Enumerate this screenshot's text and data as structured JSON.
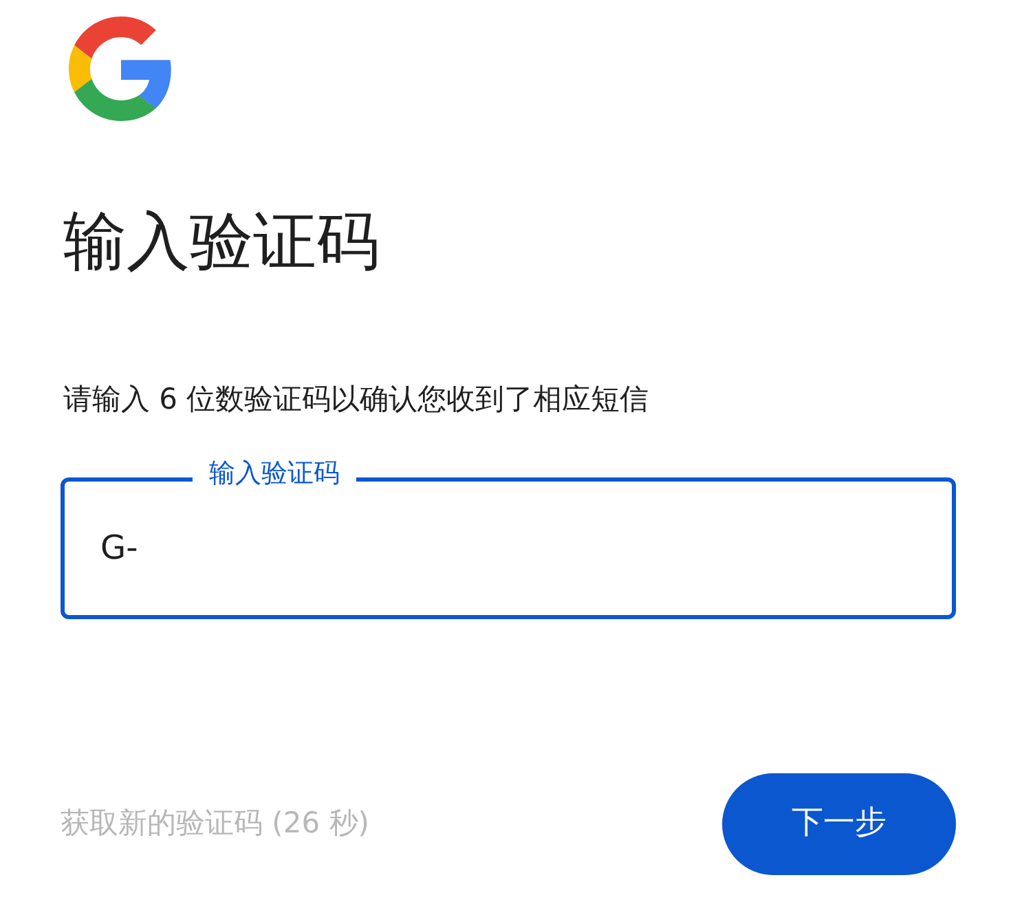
{
  "title": "输入验证码",
  "instruction": "请输入 6 位数验证码以确认您收到了相应短信",
  "code_field": {
    "label": "输入验证码",
    "value": "G-",
    "focused": true
  },
  "resend": {
    "label": "获取新的验证码 (26 秒)",
    "disabled": true
  },
  "next_button": {
    "label": "下一步"
  }
}
